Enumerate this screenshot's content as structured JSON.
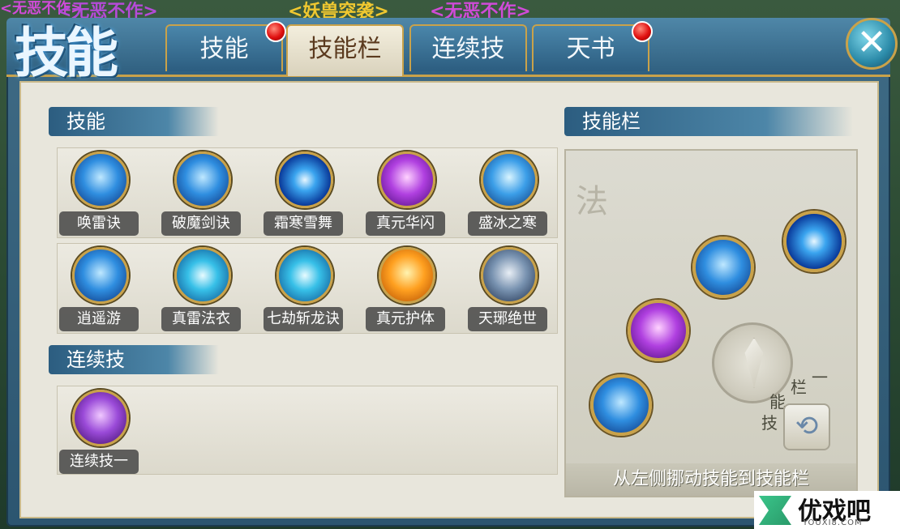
{
  "top_strip": {
    "left_name": "<无恶不作>",
    "mid_name": "<妖兽突袭>",
    "right_name": "<无恶不作>",
    "tiny_name": "<无恶不作>"
  },
  "window": {
    "title": "技能",
    "tabs": [
      {
        "label": "技能",
        "badge": true,
        "active": false
      },
      {
        "label": "技能栏",
        "badge": false,
        "active": true
      },
      {
        "label": "连续技",
        "badge": false,
        "active": false
      },
      {
        "label": "天书",
        "badge": true,
        "active": false
      }
    ],
    "close_glyph": "✕"
  },
  "skills_section": {
    "title": "技能",
    "row1": [
      {
        "name": "唤雷诀",
        "icon": "lightning-orb-icon",
        "color": "blue"
      },
      {
        "name": "破魔剑诀",
        "icon": "sword-wind-orb-icon",
        "color": "blue"
      },
      {
        "name": "霜寒雪舞",
        "icon": "swirl-orb-icon",
        "color": "blue"
      },
      {
        "name": "真元华闪",
        "icon": "purple-burst-orb-icon",
        "color": "purple"
      },
      {
        "name": "盛冰之寒",
        "icon": "ice-crystal-orb-icon",
        "color": "blue"
      }
    ],
    "row2": [
      {
        "name": "逍遥游",
        "icon": "wind-orb-icon",
        "color": "blue"
      },
      {
        "name": "真雷法衣",
        "icon": "thunder-shield-orb-icon",
        "color": "cyan"
      },
      {
        "name": "七劫斩龙诀",
        "icon": "sword-strike-orb-icon",
        "color": "cyan"
      },
      {
        "name": "真元护体",
        "icon": "fire-shield-orb-icon",
        "color": "orange"
      },
      {
        "name": "天琊绝世",
        "icon": "taiji-orb-icon",
        "color": "gray"
      }
    ]
  },
  "combo_section": {
    "title": "连续技",
    "items": [
      {
        "name": "连续技一",
        "icon": "combo-crystal-orb-icon",
        "color": "purple"
      }
    ]
  },
  "skill_bar": {
    "title": "技能栏",
    "calligraphy": "法",
    "hint": "从左侧挪动技能到技能栏",
    "switch_label": [
      "技",
      "能",
      "栏",
      "一"
    ],
    "switch_glyph": "⟲",
    "slots": [
      {
        "icon": "swirl-orb-icon"
      },
      {
        "icon": "lightning-orb-icon"
      },
      {
        "icon": "purple-burst-orb-icon"
      },
      {
        "icon": "lightning-orb-icon"
      }
    ]
  },
  "watermark": {
    "title": "优戏吧",
    "subtitle": "YOUXI8.COM"
  },
  "colors": {
    "accent_gold": "#c9a24a",
    "header_blue": "#2f5f7f",
    "badge_red": "#e01010"
  }
}
